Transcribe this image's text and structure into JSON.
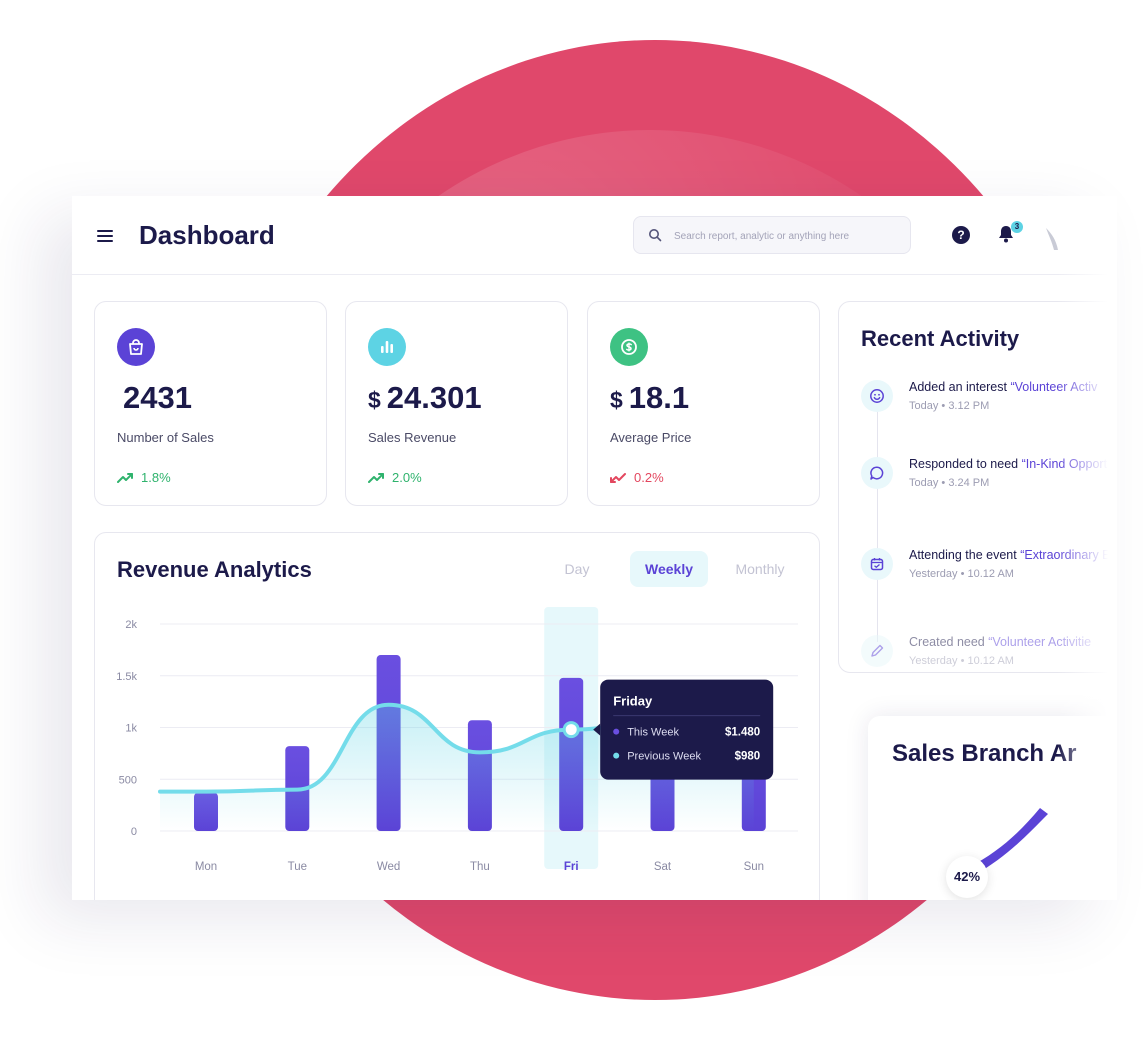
{
  "colors": {
    "accent": "#5b43d6",
    "brand_bg": "#e0486b",
    "cyan": "#5dd3e4",
    "up": "#2fb36d",
    "down": "#e3475f"
  },
  "header": {
    "title": "Dashboard",
    "search_placeholder": "Search report, analytic or anything here",
    "notification_count": "3",
    "help_glyph": "?"
  },
  "stats": [
    {
      "icon": "shopping-bag-icon",
      "currency": "",
      "value": "2431",
      "label": "Number of Sales",
      "trend": "1.8%",
      "direction": "up"
    },
    {
      "icon": "bar-chart-icon",
      "currency": "$",
      "value": "24.301",
      "label": "Sales Revenue",
      "trend": "2.0%",
      "direction": "up"
    },
    {
      "icon": "dollar-coin-icon",
      "currency": "$",
      "value": "18.1",
      "label": "Average Price",
      "trend": "0.2%",
      "direction": "down"
    }
  ],
  "revenue": {
    "title": "Revenue Analytics",
    "tabs": [
      {
        "label": "Day",
        "active": false
      },
      {
        "label": "Weekly",
        "active": true
      },
      {
        "label": "Monthly",
        "active": false
      }
    ]
  },
  "chart_data": {
    "type": "bar",
    "title": "Revenue Analytics",
    "categories": [
      "Mon",
      "Tue",
      "Wed",
      "Thu",
      "Fri",
      "Sat",
      "Sun"
    ],
    "ylim": [
      0,
      2000
    ],
    "y_ticks": [
      {
        "value": 0,
        "label": "0"
      },
      {
        "value": 500,
        "label": "500"
      },
      {
        "value": 1000,
        "label": "1k"
      },
      {
        "value": 1500,
        "label": "1.5k"
      },
      {
        "value": 2000,
        "label": "2k"
      }
    ],
    "series": [
      {
        "name": "This Week",
        "type": "bar",
        "values": [
          370,
          820,
          1700,
          1070,
          1480,
          1080,
          1020
        ]
      },
      {
        "name": "Previous Week",
        "type": "line",
        "values": [
          380,
          400,
          1220,
          760,
          980,
          1070,
          1050
        ]
      }
    ],
    "highlight": {
      "category": "Fri",
      "title": "Friday",
      "rows": [
        {
          "name": "This Week",
          "value": "$1.480"
        },
        {
          "name": "Previous Week",
          "value": "$980"
        }
      ]
    },
    "grid": true,
    "legend": "none"
  },
  "activity": {
    "title": "Recent Activity",
    "items": [
      {
        "icon": "smile-icon",
        "prefix": "Added an interest ",
        "highlight": "“Volunteer Activ",
        "time": "Today • 3.12 PM"
      },
      {
        "icon": "chat-bubble-icon",
        "prefix": "Responded to need ",
        "highlight": "“In-Kind Opportunity”",
        "time": "Today • 3.24 PM"
      },
      {
        "icon": "calendar-icon",
        "prefix": "Attending the event ",
        "highlight": "“Extraordinary Event”",
        "time": "Yesterday • 10.12 AM"
      },
      {
        "icon": "pencil-icon",
        "prefix": "Created need ",
        "highlight": "“Volunteer Activitie",
        "time": "Yesterday • 10.12 AM"
      }
    ]
  },
  "branch": {
    "title": "Sales Branch Ar",
    "percent_label": "42%",
    "percent": 42
  }
}
